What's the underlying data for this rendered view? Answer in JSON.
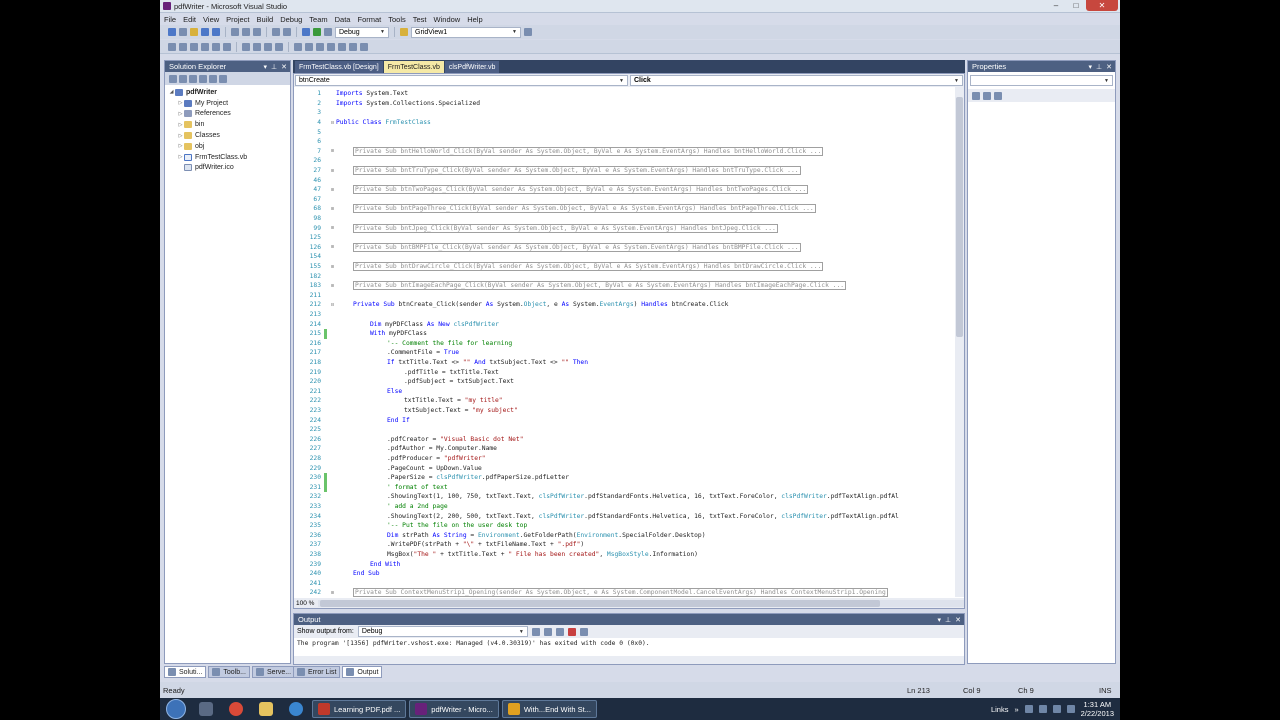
{
  "window": {
    "title": "pdfWriter - Microsoft Visual Studio",
    "controls": [
      "–",
      "□",
      "✕"
    ]
  },
  "menu": [
    "File",
    "Edit",
    "View",
    "Project",
    "Build",
    "Debug",
    "Team",
    "Data",
    "Format",
    "Tools",
    "Test",
    "Window",
    "Help"
  ],
  "toolbar": {
    "config": "Debug",
    "find_combo": "GridView1"
  },
  "solution_explorer": {
    "title": "Solution Explorer",
    "items": [
      {
        "label": "pdfWriter",
        "kind": "proj",
        "indent": 0,
        "expander": "◢"
      },
      {
        "label": "My Project",
        "kind": "proj",
        "indent": 1,
        "expander": "▷"
      },
      {
        "label": "References",
        "kind": "ref",
        "indent": 1,
        "expander": "▷"
      },
      {
        "label": "bin",
        "kind": "folder",
        "indent": 1,
        "expander": "▷"
      },
      {
        "label": "Classes",
        "kind": "folder",
        "indent": 1,
        "expander": "▷"
      },
      {
        "label": "obj",
        "kind": "folder",
        "indent": 1,
        "expander": "▷"
      },
      {
        "label": "FrmTestClass.vb",
        "kind": "vb",
        "indent": 1,
        "expander": "▷"
      },
      {
        "label": "pdfWriter.ico",
        "kind": "file",
        "indent": 1,
        "expander": ""
      }
    ]
  },
  "left_tabs": [
    "Soluti...",
    "Toolb...",
    "Serve..."
  ],
  "doc_tabs": [
    {
      "label": "FrmTestClass.vb [Design]",
      "active": false
    },
    {
      "label": "FrmTestClass.vb",
      "active": true
    },
    {
      "label": "clsPdfWriter.vb",
      "active": false
    }
  ],
  "navbar": {
    "object": "btnCreate",
    "member": "Click"
  },
  "code_lines": [
    {
      "n": "1",
      "t": "Imports System.Text",
      "indent": 0
    },
    {
      "n": "2",
      "t": "Imports System.Collections.Specialized",
      "indent": 0
    },
    {
      "n": "3",
      "t": "",
      "indent": 0
    },
    {
      "n": "4",
      "t": "Public Class FrmTestClass",
      "indent": 0,
      "outline": "⊟"
    },
    {
      "n": "5",
      "t": "",
      "indent": 0
    },
    {
      "n": "6",
      "t": "",
      "indent": 0
    },
    {
      "n": "7",
      "t": "Private Sub bntHelloWorld_Click(ByVal sender As System.Object, ByVal e As System.EventArgs) Handles bntHelloWorld.Click ...",
      "indent": 1,
      "outline": "⊞",
      "collapsed": true
    },
    {
      "n": "26",
      "t": "",
      "indent": 0
    },
    {
      "n": "27",
      "t": "Private Sub bntTruType_Click(ByVal sender As System.Object, ByVal e As System.EventArgs) Handles bntTruType.Click ...",
      "indent": 1,
      "outline": "⊞",
      "collapsed": true
    },
    {
      "n": "46",
      "t": "",
      "indent": 0
    },
    {
      "n": "47",
      "t": "Private Sub btnTwoPages_Click(ByVal sender As System.Object, ByVal e As System.EventArgs) Handles bntTwoPages.Click ...",
      "indent": 1,
      "outline": "⊞",
      "collapsed": true
    },
    {
      "n": "67",
      "t": "",
      "indent": 0
    },
    {
      "n": "68",
      "t": "Private Sub bntPageThree_Click(ByVal sender As System.Object, ByVal e As System.EventArgs) Handles bntPageThree.Click ...",
      "indent": 1,
      "outline": "⊞",
      "collapsed": true
    },
    {
      "n": "98",
      "t": "",
      "indent": 0
    },
    {
      "n": "99",
      "t": "Private Sub bntJpeg_Click(ByVal sender As System.Object, ByVal e As System.EventArgs) Handles bntJpeg.Click ...",
      "indent": 1,
      "outline": "⊞",
      "collapsed": true
    },
    {
      "n": "125",
      "t": "",
      "indent": 0
    },
    {
      "n": "126",
      "t": "Private Sub bntBMPFile_Click(ByVal sender As System.Object, ByVal e As System.EventArgs) Handles bntBMPFile.Click ...",
      "indent": 1,
      "outline": "⊞",
      "collapsed": true
    },
    {
      "n": "154",
      "t": "",
      "indent": 0
    },
    {
      "n": "155",
      "t": "Private Sub bntDrawCircle_Click(ByVal sender As System.Object, ByVal e As System.EventArgs) Handles bntDrawCircle.Click ...",
      "indent": 1,
      "outline": "⊞",
      "collapsed": true
    },
    {
      "n": "182",
      "t": "",
      "indent": 0
    },
    {
      "n": "183",
      "t": "Private Sub bntImageEachPage_Click(ByVal sender As System.Object, ByVal e As System.EventArgs) Handles bntImageEachPage.Click ...",
      "indent": 1,
      "outline": "⊞",
      "collapsed": true
    },
    {
      "n": "211",
      "t": "",
      "indent": 0
    },
    {
      "n": "212",
      "t": "Private Sub btnCreate_Click(sender As System.Object, e As System.EventArgs) Handles btnCreate.Click",
      "indent": 1,
      "outline": "⊟"
    },
    {
      "n": "213",
      "t": "",
      "indent": 0
    },
    {
      "n": "214",
      "t": "Dim myPDFClass As New clsPdfWriter",
      "indent": 2
    },
    {
      "n": "215",
      "t": "With myPDFClass",
      "indent": 2,
      "changed": true
    },
    {
      "n": "216",
      "t": "'-- Comment the file for learning",
      "indent": 3,
      "comment": true
    },
    {
      "n": "217",
      "t": ".CommentFile = True",
      "indent": 3
    },
    {
      "n": "218",
      "t": "If txtTitle.Text <> \"\" And txtSubject.Text <> \"\" Then",
      "indent": 3
    },
    {
      "n": "219",
      "t": ".pdfTitle = txtTitle.Text",
      "indent": 4
    },
    {
      "n": "220",
      "t": ".pdfSubject = txtSubject.Text",
      "indent": 4
    },
    {
      "n": "221",
      "t": "Else",
      "indent": 3
    },
    {
      "n": "222",
      "t": "txtTitle.Text = \"my title\"",
      "indent": 4
    },
    {
      "n": "223",
      "t": "txtSubject.Text = \"my subject\"",
      "indent": 4
    },
    {
      "n": "224",
      "t": "End If",
      "indent": 3
    },
    {
      "n": "225",
      "t": "",
      "indent": 0
    },
    {
      "n": "226",
      "t": ".pdfCreator = \"Visual Basic dot Net\"",
      "indent": 3
    },
    {
      "n": "227",
      "t": ".pdfAuthor = My.Computer.Name",
      "indent": 3
    },
    {
      "n": "228",
      "t": ".pdfProducer = \"pdfWriter\"",
      "indent": 3
    },
    {
      "n": "229",
      "t": ".PageCount = UpDown.Value",
      "indent": 3
    },
    {
      "n": "230",
      "t": ".PaperSize = clsPdfWriter.pdfPaperSize.pdfLetter",
      "indent": 3,
      "changed": true
    },
    {
      "n": "231",
      "t": "' format of text",
      "indent": 3,
      "comment": true,
      "changed": true
    },
    {
      "n": "232",
      "t": ".ShowingText(1, 100, 750, txtText.Text, clsPdfWriter.pdfStandardFonts.Helvetica, 16, txtText.ForeColor, clsPdfWriter.pdfTextAlign.pdfAl",
      "indent": 3
    },
    {
      "n": "233",
      "t": "' add a 2nd page",
      "indent": 3,
      "comment": true
    },
    {
      "n": "234",
      "t": ".ShowingText(2, 200, 500, txtText.Text, clsPdfWriter.pdfStandardFonts.Helvetica, 16, txtText.ForeColor, clsPdfWriter.pdfTextAlign.pdfAl",
      "indent": 3
    },
    {
      "n": "235",
      "t": "'-- Put the file on the user desk top",
      "indent": 3,
      "comment": true
    },
    {
      "n": "236",
      "t": "Dim strPath As String = Environment.GetFolderPath(Environment.SpecialFolder.Desktop)",
      "indent": 3
    },
    {
      "n": "237",
      "t": ".WritePDF(strPath + \"\\\" + txtFileName.Text + \".pdf\")",
      "indent": 3
    },
    {
      "n": "238",
      "t": "MsgBox(\"The \" + txtTitle.Text + \" File has been created\", MsgBoxStyle.Information)",
      "indent": 3
    },
    {
      "n": "239",
      "t": "End With",
      "indent": 2
    },
    {
      "n": "240",
      "t": "End Sub",
      "indent": 1
    },
    {
      "n": "241",
      "t": "",
      "indent": 0
    },
    {
      "n": "242",
      "t": "Private Sub ContextMenuStrip1_Opening(sender As System.Object, e As System.ComponentModel.CancelEventArgs) Handles ContextMenuStrip1.Opening",
      "indent": 1,
      "outline": "⊞",
      "collapsed": true
    }
  ],
  "zoom_level": "100 %",
  "properties": {
    "title": "Properties"
  },
  "output": {
    "title": "Output",
    "show_from_label": "Show output from:",
    "source": "Debug",
    "text": "The program '[1356] pdfWriter.vshost.exe: Managed (v4.0.30319)' has exited with code 0 (0x0)."
  },
  "bottom_tabs": [
    {
      "label": "Error List",
      "active": false
    },
    {
      "label": "Output",
      "active": true
    }
  ],
  "status": {
    "left": "Ready",
    "ln": "Ln 213",
    "col": "Col 9",
    "ch": "Ch 9",
    "mode": "INS"
  },
  "taskbar": {
    "tasks": [
      {
        "label": "Learning PDF.pdf ...",
        "color": "#c0392b"
      },
      {
        "label": "pdfWriter - Micro...",
        "color": "#68217a"
      },
      {
        "label": "With...End With St...",
        "color": "#e0a020"
      }
    ],
    "links_label": "Links",
    "time": "1:31 AM",
    "date": "2/22/2013"
  }
}
